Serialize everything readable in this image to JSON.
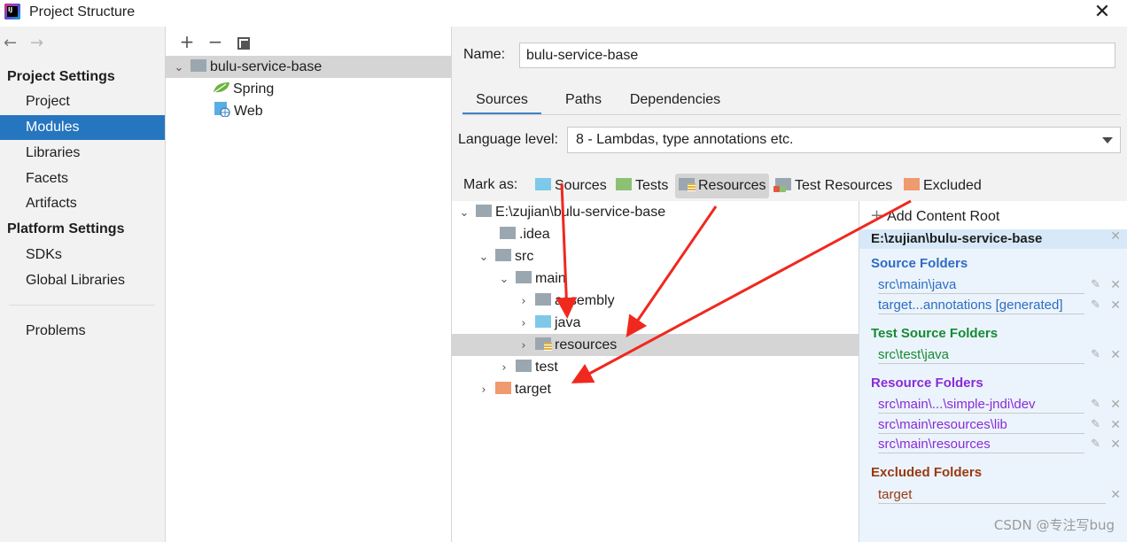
{
  "window": {
    "title": "Project Structure",
    "logo_text": "IJ"
  },
  "sidebar": {
    "project_settings_heading": "Project Settings",
    "project_settings_items": [
      "Project",
      "Modules",
      "Libraries",
      "Facets",
      "Artifacts"
    ],
    "platform_settings_heading": "Platform Settings",
    "platform_settings_items": [
      "SDKs",
      "Global Libraries"
    ],
    "problems": "Problems",
    "selected": "Modules"
  },
  "modules": {
    "root": "bulu-service-base",
    "facets": [
      "Spring",
      "Web"
    ]
  },
  "settings": {
    "name_label": "Name:",
    "name_value": "bulu-service-base",
    "tabs": [
      "Sources",
      "Paths",
      "Dependencies"
    ],
    "active_tab": "Sources",
    "language_level_label": "Language level:",
    "language_level_value": "8 - Lambdas, type annotations etc.",
    "mark_as_label": "Mark as:",
    "mark_as_buttons": [
      "Sources",
      "Tests",
      "Resources",
      "Test Resources",
      "Excluded"
    ],
    "pressed_button": "Resources"
  },
  "tree": {
    "root": "E:\\zujian\\bulu-service-base",
    "items": [
      ".idea",
      "src",
      "main",
      "assembly",
      "java",
      "resources",
      "test",
      "target"
    ],
    "selected": "resources"
  },
  "content_root": {
    "add_label": "Add Content Root",
    "path": "E:\\zujian\\bulu-service-base",
    "source_title": "Source Folders",
    "source_folders": [
      "src\\main\\java",
      "target...annotations [generated]"
    ],
    "test_source_title": "Test Source Folders",
    "test_source_folders": [
      "src\\test\\java"
    ],
    "resource_title": "Resource Folders",
    "resource_folders": [
      "src\\main\\...\\simple-jndi\\dev",
      "src\\main\\resources\\lib",
      "src\\main\\resources"
    ],
    "excluded_title": "Excluded Folders",
    "excluded_folders": [
      "target"
    ]
  },
  "watermark": "CSDN @专注写bug",
  "colors": {
    "selection": "#2675bf",
    "annotation_arrow": "#f0281e",
    "source": "#2f6cc1",
    "test": "#178a35",
    "resource": "#8a2bd8",
    "excluded": "#9a3912"
  }
}
